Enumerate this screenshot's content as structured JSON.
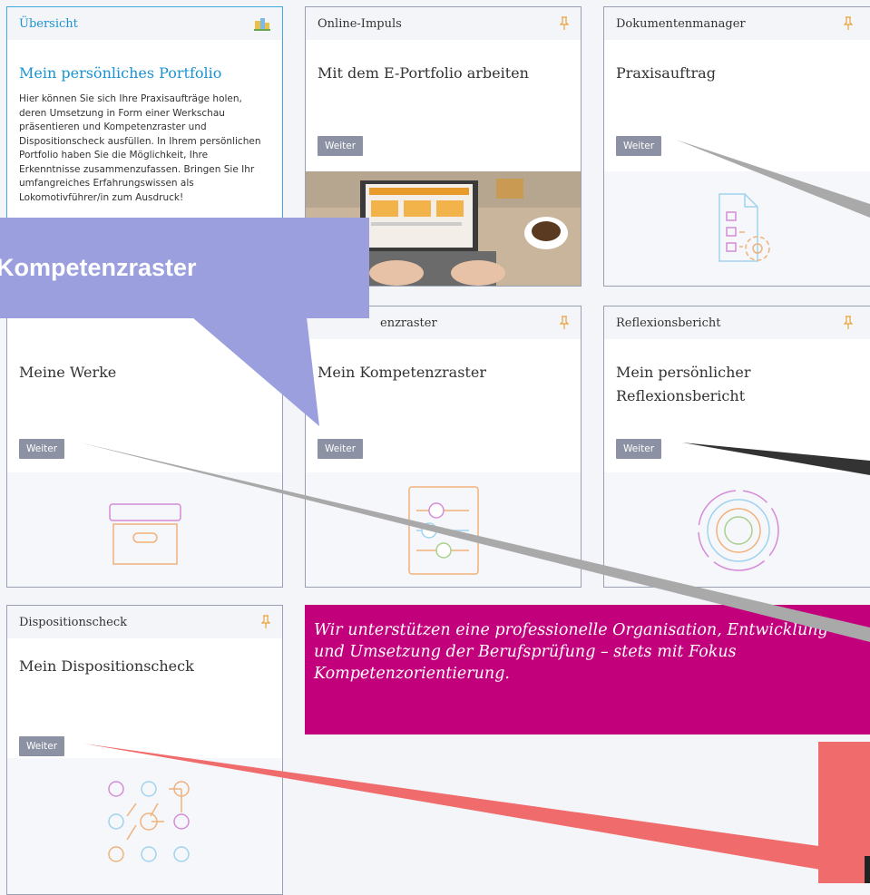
{
  "button_label": "Weiter",
  "cards": {
    "overview": {
      "header": "Übersicht",
      "title": "Mein persönliches Portfolio",
      "text": "Hier können Sie sich Ihre Praxisaufträge holen, deren Umsetzung in Form einer Werkschau präsentieren und Kompetenzraster und Dispositionscheck ausfüllen. In Ihrem persönlichen Portfolio haben Sie die Möglichkeit, Ihre Erkenntnisse zusammenzufassen. Bringen Sie Ihr umfangreiches Erfahrungswissen als Lokomotivführer/in zum Ausdruck!"
    },
    "online_impuls": {
      "header": "Online-Impuls",
      "title": "Mit dem E-Portfolio arbeiten"
    },
    "dokumentenmanager": {
      "header": "Dokumentenmanager",
      "title": "Praxisauftrag"
    },
    "werke": {
      "title": "Meine Werke"
    },
    "kompetenzraster": {
      "header": "enzraster",
      "title": "Mein Kompetenzraster"
    },
    "reflexion": {
      "header": "Reflexionsbericht",
      "title": "Mein persönlicher Reflexionsbericht"
    },
    "disposition": {
      "header": "Dispositionscheck",
      "title": "Mein Dispositionscheck"
    }
  },
  "banner": {
    "text": "Wir unterstützen eine professionelle Organisation, Entwicklung und Umsetzung der Berufsprüfung – stets mit Fokus Kompetenzorientierung."
  },
  "callout": {
    "label": "Kompetenzraster"
  },
  "colors": {
    "accent_blue": "#1b93d2",
    "banner_magenta": "#c2007b",
    "button_gray": "#8c91a3",
    "callout_purple": "#9b9fdd",
    "arrow_red": "#f06b6b"
  },
  "icons": [
    "pin-icon",
    "buildings-icon",
    "document-settings-icon",
    "archive-box-icon",
    "sliders-icon",
    "target-rings-icon",
    "network-nodes-icon"
  ]
}
